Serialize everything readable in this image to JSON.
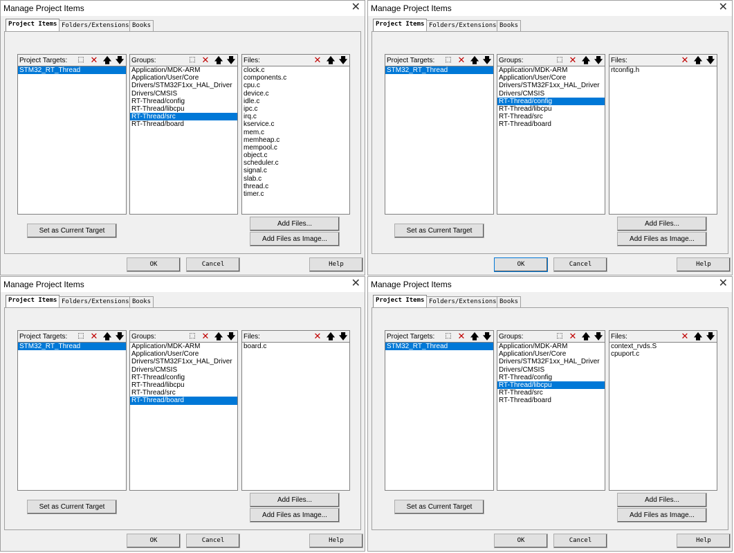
{
  "dialog_title": "Manage Project Items",
  "close_glyph": "✕",
  "tabs": [
    "Project Items",
    "Folders/Extensions",
    "Books"
  ],
  "labels": {
    "targets": "Project Targets:",
    "groups": "Groups:",
    "files": "Files:"
  },
  "toolbar_glyphs": {
    "new": "⬚",
    "delete": "✕",
    "up": "🡅",
    "down": "🡇"
  },
  "icons": {
    "new": "new-item-icon",
    "delete": "delete-icon",
    "up": "move-up-icon",
    "down": "move-down-icon",
    "close": "close-icon"
  },
  "colors": {
    "selection": "#0078d7",
    "delete_icon": "#c00000"
  },
  "buttons": {
    "set_target": "Set as Current Target",
    "add_files": "Add Files...",
    "add_files_image": "Add Files as Image...",
    "ok": "OK",
    "cancel": "Cancel",
    "help": "Help"
  },
  "targets": [
    "STM32_RT_Thread"
  ],
  "groups": [
    "Application/MDK-ARM",
    "Application/User/Core",
    "Drivers/STM32F1xx_HAL_Driver",
    "Drivers/CMSIS",
    "RT-Thread/config",
    "RT-Thread/libcpu",
    "RT-Thread/src",
    "RT-Thread/board"
  ],
  "dialogs": [
    {
      "selected_group": "RT-Thread/src",
      "files": [
        "clock.c",
        "components.c",
        "cpu.c",
        "device.c",
        "idle.c",
        "ipc.c",
        "irq.c",
        "kservice.c",
        "mem.c",
        "memheap.c",
        "mempool.c",
        "object.c",
        "scheduler.c",
        "signal.c",
        "slab.c",
        "thread.c",
        "timer.c"
      ]
    },
    {
      "selected_group": "RT-Thread/config",
      "files": [
        "rtconfig.h"
      ]
    },
    {
      "selected_group": "RT-Thread/board",
      "files": [
        "board.c"
      ]
    },
    {
      "selected_group": "RT-Thread/libcpu",
      "files": [
        "context_rvds.S",
        "cpuport.c"
      ]
    }
  ]
}
